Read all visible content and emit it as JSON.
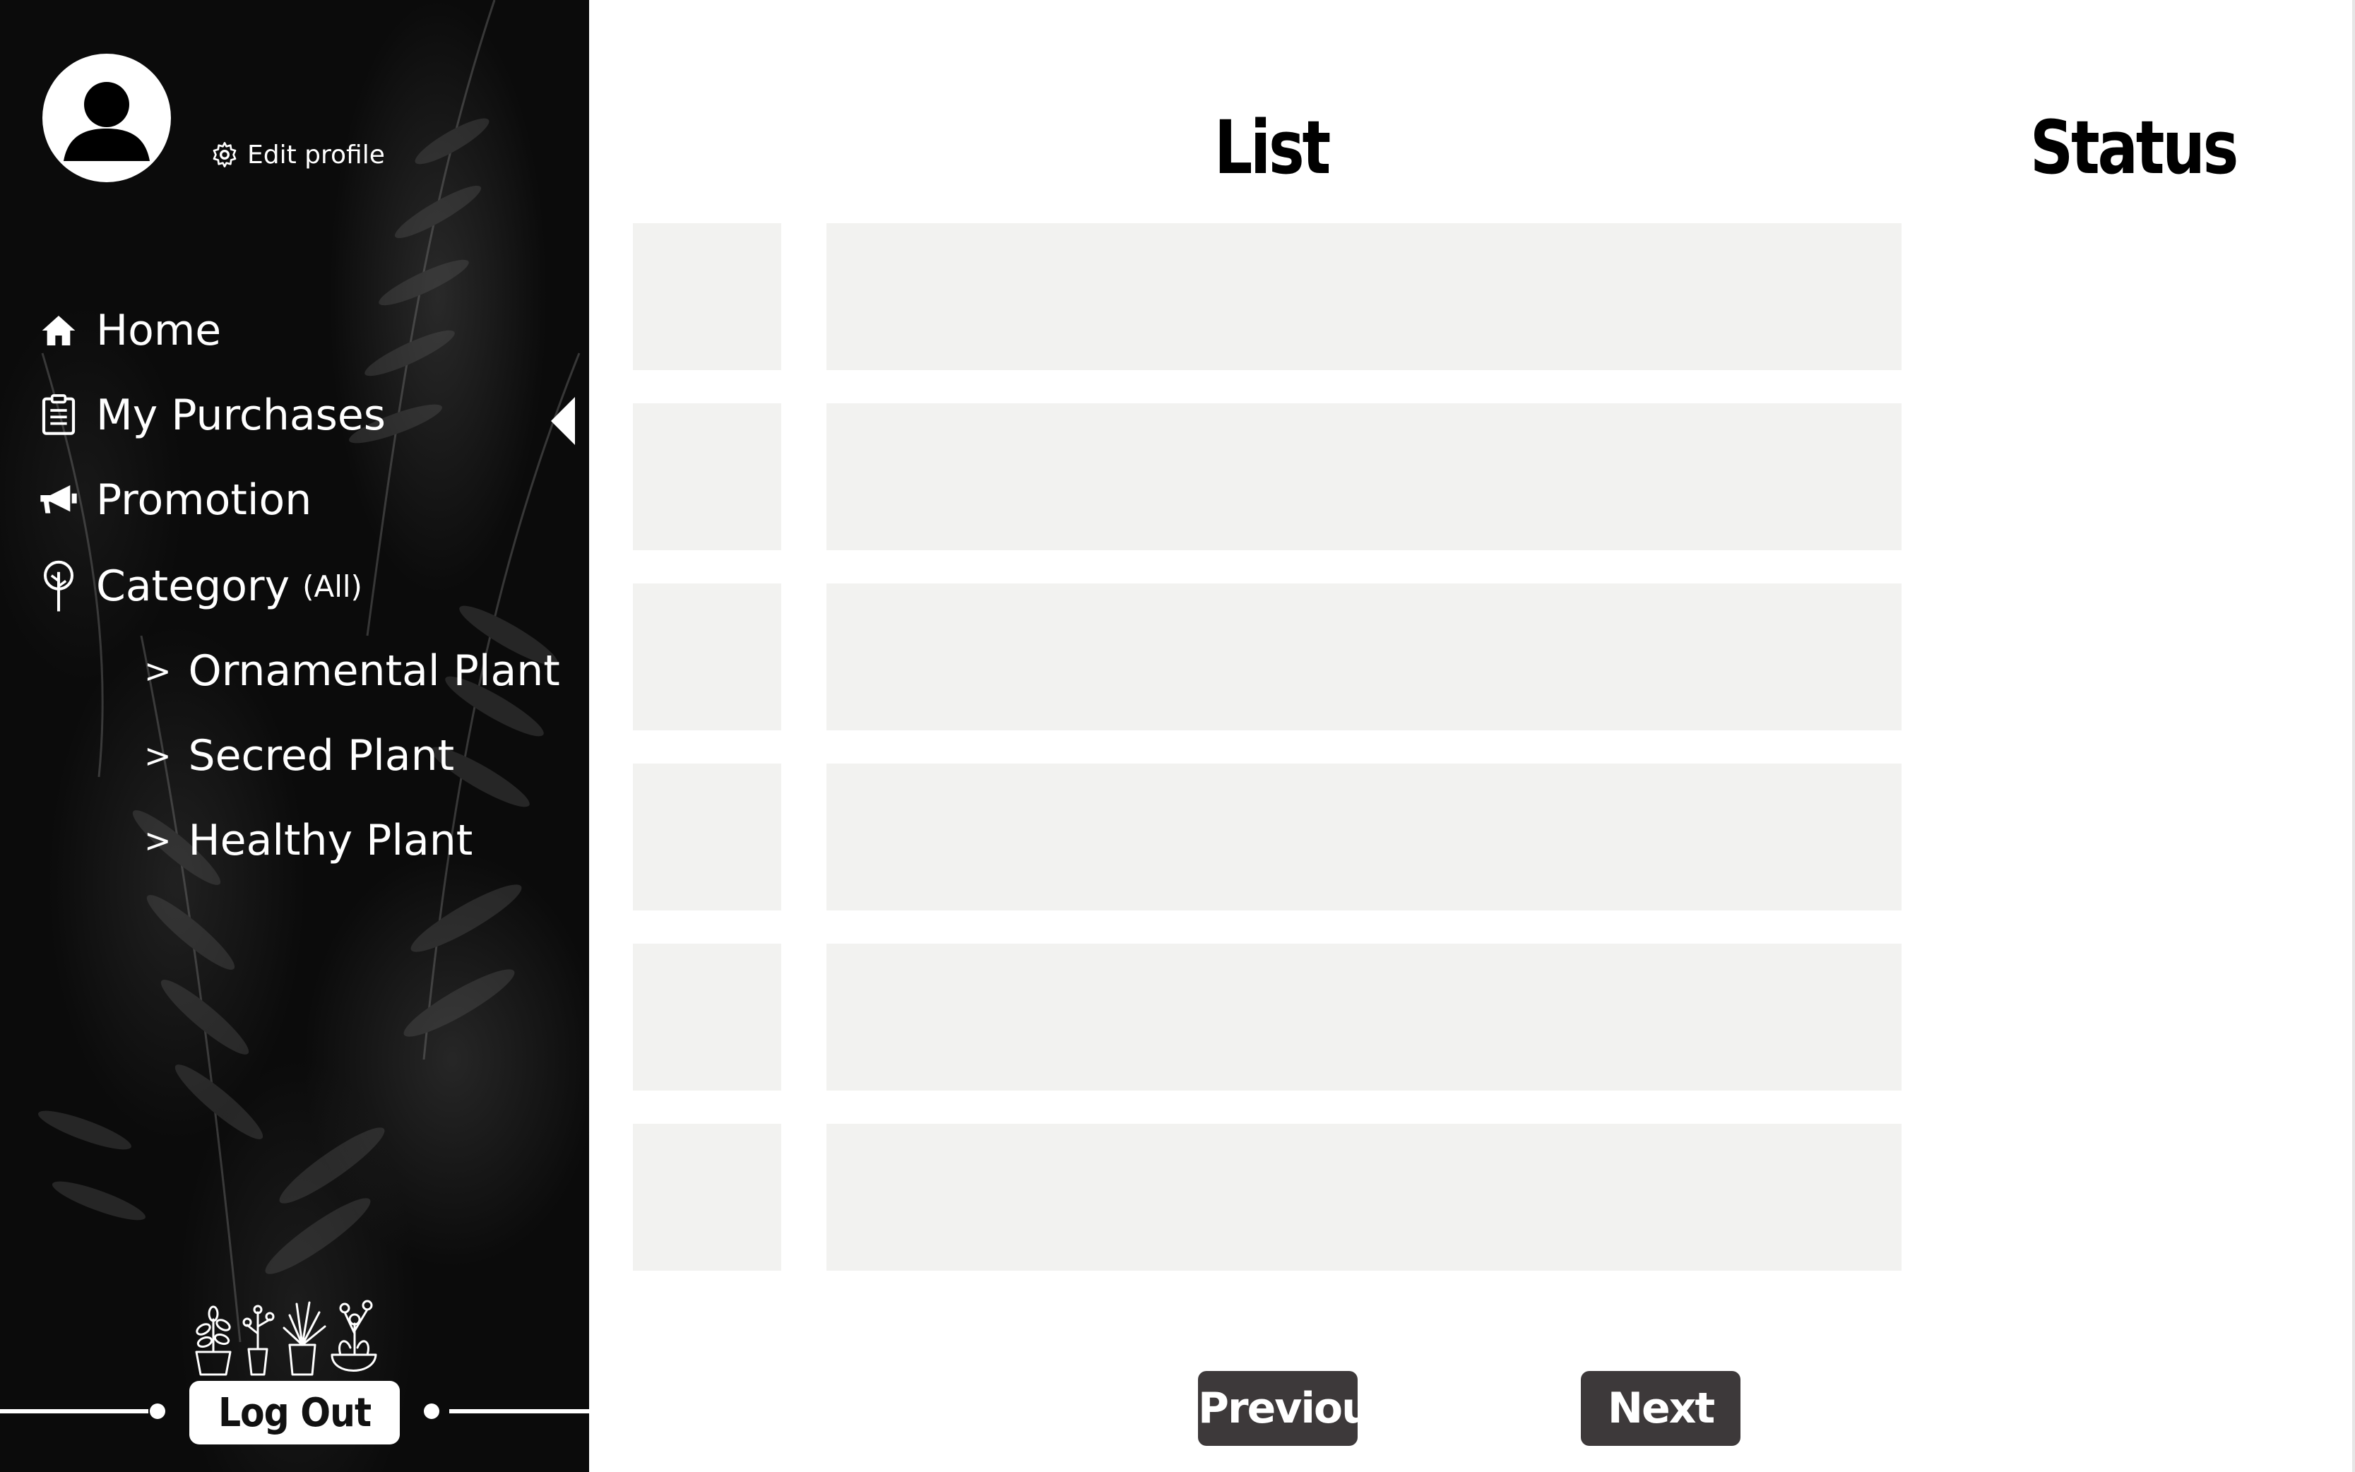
{
  "sidebar": {
    "edit_profile_label": "Edit profile",
    "nav": [
      {
        "label": "Home",
        "icon": "home-icon"
      },
      {
        "label": "My Purchases",
        "icon": "clipboard-icon",
        "active": true
      },
      {
        "label": "Promotion",
        "icon": "megaphone-icon"
      },
      {
        "label": "Category",
        "sub_label": "(All)",
        "icon": "tree-icon"
      }
    ],
    "categories": [
      {
        "chevron": ">",
        "label": "Ornamental Plant"
      },
      {
        "chevron": ">",
        "label": "Secred Plant"
      },
      {
        "chevron": ">",
        "label": "Healthy Plant"
      }
    ],
    "logout_label": "Log Out",
    "decoration_icon": "potted-plants-icon"
  },
  "main": {
    "columns": {
      "list": "List",
      "status": "Status"
    },
    "rows": [
      {},
      {},
      {},
      {},
      {},
      {}
    ],
    "pagination": {
      "previous_label": "Previous",
      "next_label": "Next"
    }
  },
  "colors": {
    "sidebar_bg": "#0b0b0b",
    "row_placeholder": "#f2f2f0",
    "pager_button": "#3d393a",
    "text_on_dark": "#ffffff"
  }
}
